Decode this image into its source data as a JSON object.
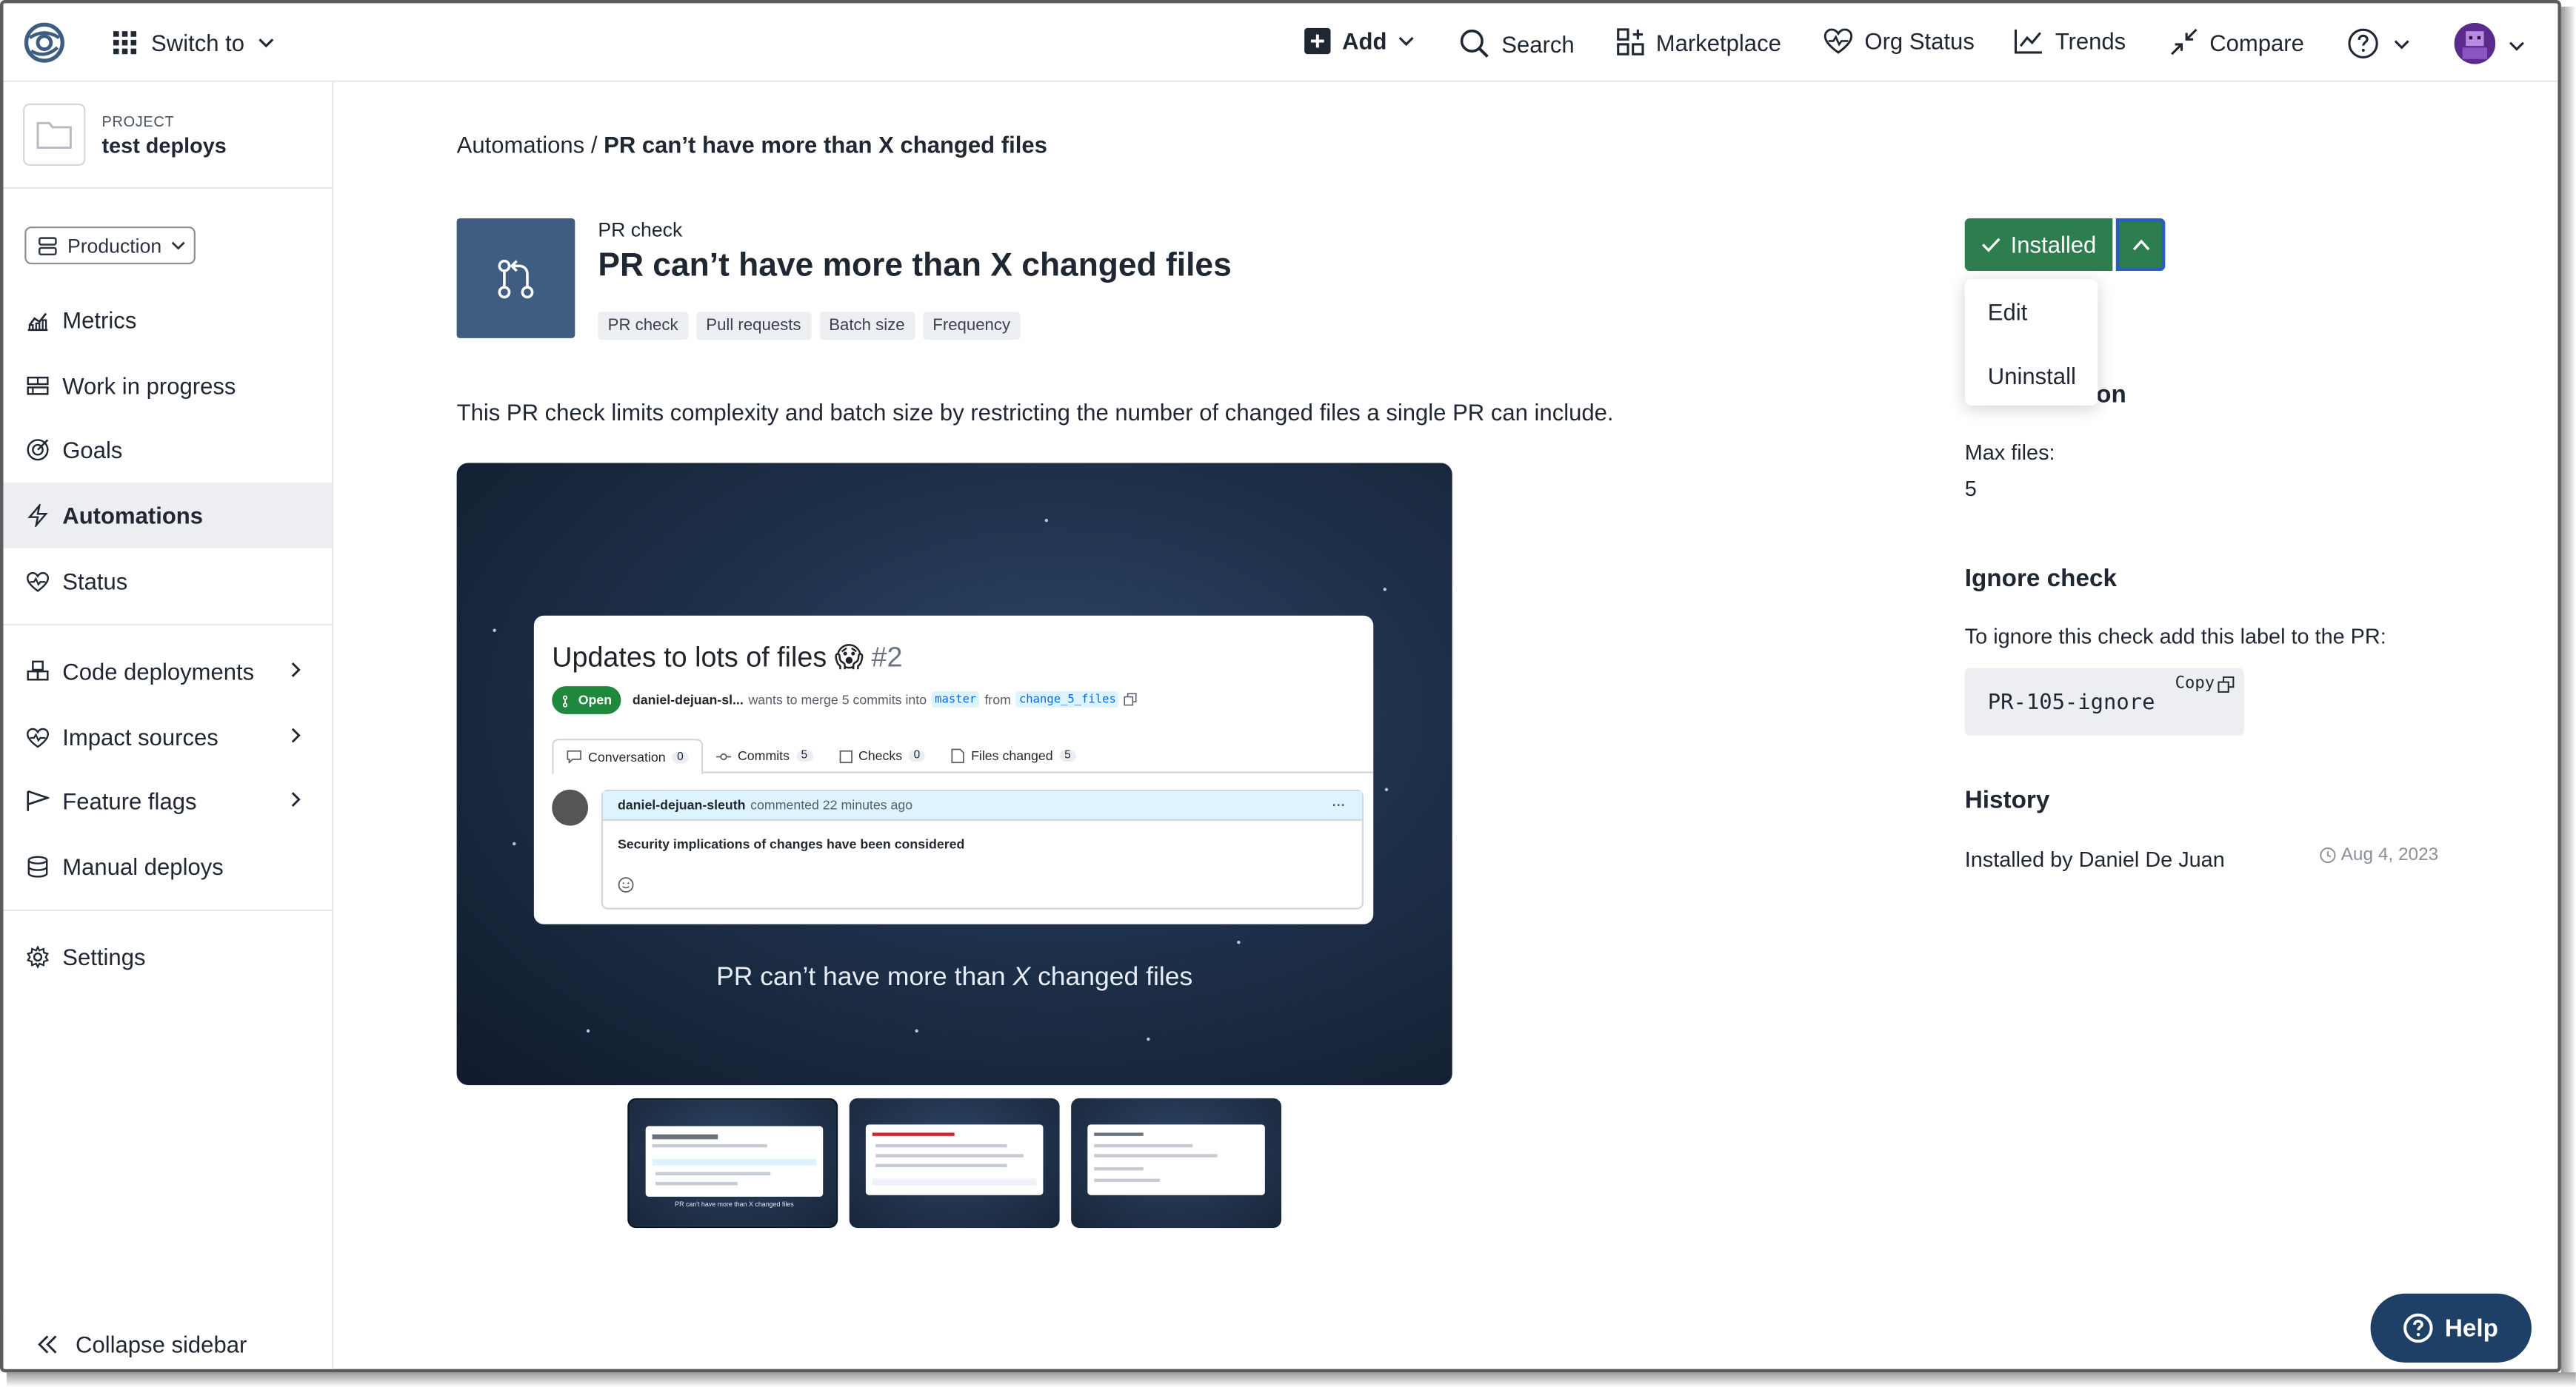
{
  "topbar": {
    "switch_label": "Switch to",
    "add_label": "Add",
    "search_label": "Search",
    "marketplace_label": "Marketplace",
    "org_status_label": "Org Status",
    "trends_label": "Trends",
    "compare_label": "Compare",
    "accent_color": "#2a5dbf"
  },
  "sidebar": {
    "project_label": "PROJECT",
    "project_name": "test deploys",
    "environment": "Production",
    "items": [
      {
        "label": "Metrics",
        "icon": "metrics-icon"
      },
      {
        "label": "Work in progress",
        "icon": "work-in-progress-icon"
      },
      {
        "label": "Goals",
        "icon": "goals-icon"
      },
      {
        "label": "Automations",
        "icon": "lightning-icon",
        "active": true
      },
      {
        "label": "Status",
        "icon": "heart-pulse-icon"
      },
      {
        "label": "Code deployments",
        "icon": "cubes-icon"
      },
      {
        "label": "Impact sources",
        "icon": "heart-pulse-icon"
      },
      {
        "label": "Feature flags",
        "icon": "flag-icon"
      },
      {
        "label": "Manual deploys",
        "icon": "database-icon"
      },
      {
        "label": "Settings",
        "icon": "gear-icon"
      }
    ],
    "collapse_label": "Collapse sidebar"
  },
  "breadcrumb": {
    "parent": "Automations",
    "separator": " / ",
    "current": "PR can’t have more than X changed files"
  },
  "automation": {
    "kicker": "PR check",
    "title": "PR can’t have more than X changed files",
    "tags": [
      "PR check",
      "Pull requests",
      "Batch size",
      "Frequency"
    ],
    "description": "This PR check limits complexity and batch size by restricting the number of changed files a single PR can include.",
    "hero_color": "#3e5d80"
  },
  "preview": {
    "pr_title": "Updates to lots of files 😱",
    "pr_number": "#2",
    "status_badge": "Open",
    "author": "daniel-dejuan-sl...",
    "merge_text": "wants to merge 5 commits into",
    "base_branch": "master",
    "from_text": "from",
    "head_branch": "change_5_files",
    "tabs": [
      {
        "label": "Conversation",
        "count": "0"
      },
      {
        "label": "Commits",
        "count": "5"
      },
      {
        "label": "Checks",
        "count": "0"
      },
      {
        "label": "Files changed",
        "count": "5"
      }
    ],
    "comment_author": "daniel-dejuan-sleuth",
    "comment_meta": "commented 22 minutes ago",
    "comment_more": "···",
    "comment_body": "Security implications of changes have been considered",
    "caption_pre": "PR can’t have more than ",
    "caption_em": "X",
    "caption_post": " changed files",
    "thumb_caption": "PR can't have more than X changed files"
  },
  "actions": {
    "installed_label": "Installed",
    "installed_color": "#2e7d4f",
    "menu": [
      "Edit",
      "Uninstall"
    ]
  },
  "configuration": {
    "heading_visible": "on",
    "max_files_label": "Max files:",
    "max_files_value": "5"
  },
  "ignore_check": {
    "heading": "Ignore check",
    "text": "To ignore this check add this label to the PR:",
    "label_code": "PR-105-ignore",
    "copy_label": "Copy"
  },
  "history": {
    "heading": "History",
    "entry": "Installed by Daniel De Juan",
    "date": "Aug 4, 2023"
  },
  "help_label": "Help"
}
